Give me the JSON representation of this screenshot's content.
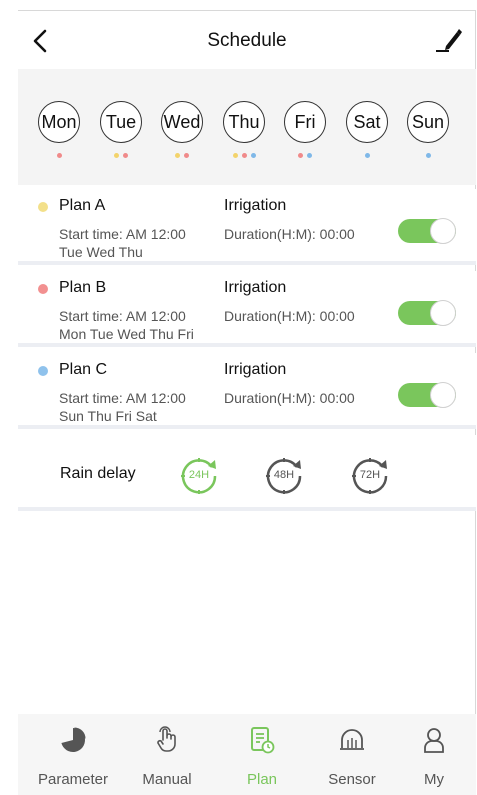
{
  "header": {
    "title": "Schedule"
  },
  "days": [
    {
      "label": "Mon",
      "dots": [
        "#f08a8a"
      ]
    },
    {
      "label": "Tue",
      "dots": [
        "#f3d36b",
        "#f08a8a"
      ]
    },
    {
      "label": "Wed",
      "dots": [
        "#f3d36b",
        "#f08a8a"
      ]
    },
    {
      "label": "Thu",
      "dots": [
        "#f3d36b",
        "#f08a8a",
        "#7fb8e8"
      ]
    },
    {
      "label": "Fri",
      "dots": [
        "#f08a8a",
        "#7fb8e8"
      ]
    },
    {
      "label": "Sat",
      "dots": [
        "#7fb8e8"
      ]
    },
    {
      "label": "Sun",
      "dots": [
        "#7fb8e8"
      ]
    }
  ],
  "plans": [
    {
      "name": "Plan A",
      "color": "#f3e08a",
      "start": "Start time: AM 12:00",
      "days": "Tue Wed Thu",
      "type": "Irrigation",
      "duration": "Duration(H:M): 00:00",
      "enabled": true
    },
    {
      "name": "Plan B",
      "color": "#f29090",
      "start": "Start time: AM 12:00",
      "days": "Mon Tue Wed Thu Fri",
      "type": "Irrigation",
      "duration": "Duration(H:M): 00:00",
      "enabled": true
    },
    {
      "name": "Plan C",
      "color": "#8fc2ec",
      "start": "Start time: AM 12:00",
      "days": "Sun Thu Fri Sat",
      "type": "Irrigation",
      "duration": "Duration(H:M): 00:00",
      "enabled": true
    }
  ],
  "rain_delay": {
    "label": "Rain delay",
    "options": [
      {
        "label": "24H",
        "active": true
      },
      {
        "label": "48H",
        "active": false
      },
      {
        "label": "72H",
        "active": false
      }
    ]
  },
  "nav": {
    "items": [
      {
        "label": "Parameter",
        "icon": "pie-chart-icon",
        "active": false
      },
      {
        "label": "Manual",
        "icon": "hand-pointer-icon",
        "active": false
      },
      {
        "label": "Plan",
        "icon": "plan-calendar-icon",
        "active": true
      },
      {
        "label": "Sensor",
        "icon": "sensor-dome-icon",
        "active": false
      },
      {
        "label": "My",
        "icon": "user-icon",
        "active": false
      }
    ]
  },
  "colors": {
    "accent": "#7ac65c",
    "inactive": "#555555"
  }
}
